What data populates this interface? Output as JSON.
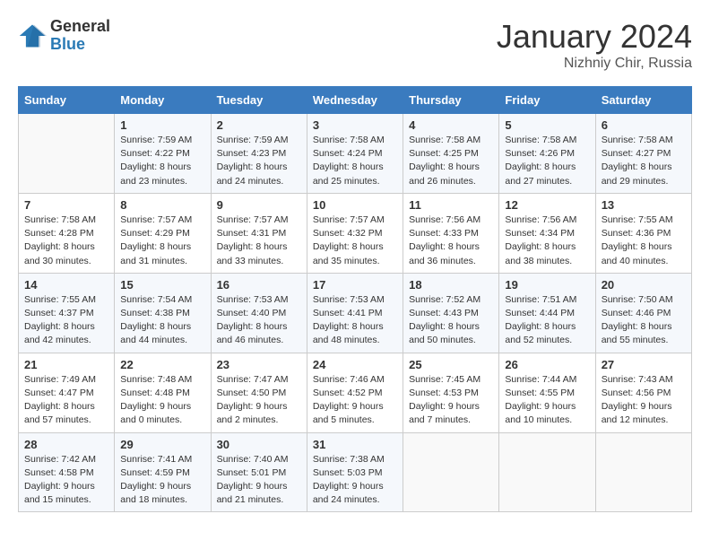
{
  "header": {
    "logo_general": "General",
    "logo_blue": "Blue",
    "month_year": "January 2024",
    "location": "Nizhniy Chir, Russia"
  },
  "weekdays": [
    "Sunday",
    "Monday",
    "Tuesday",
    "Wednesday",
    "Thursday",
    "Friday",
    "Saturday"
  ],
  "weeks": [
    [
      {
        "day": "",
        "info": ""
      },
      {
        "day": "1",
        "info": "Sunrise: 7:59 AM\nSunset: 4:22 PM\nDaylight: 8 hours\nand 23 minutes."
      },
      {
        "day": "2",
        "info": "Sunrise: 7:59 AM\nSunset: 4:23 PM\nDaylight: 8 hours\nand 24 minutes."
      },
      {
        "day": "3",
        "info": "Sunrise: 7:58 AM\nSunset: 4:24 PM\nDaylight: 8 hours\nand 25 minutes."
      },
      {
        "day": "4",
        "info": "Sunrise: 7:58 AM\nSunset: 4:25 PM\nDaylight: 8 hours\nand 26 minutes."
      },
      {
        "day": "5",
        "info": "Sunrise: 7:58 AM\nSunset: 4:26 PM\nDaylight: 8 hours\nand 27 minutes."
      },
      {
        "day": "6",
        "info": "Sunrise: 7:58 AM\nSunset: 4:27 PM\nDaylight: 8 hours\nand 29 minutes."
      }
    ],
    [
      {
        "day": "7",
        "info": "Sunrise: 7:58 AM\nSunset: 4:28 PM\nDaylight: 8 hours\nand 30 minutes."
      },
      {
        "day": "8",
        "info": "Sunrise: 7:57 AM\nSunset: 4:29 PM\nDaylight: 8 hours\nand 31 minutes."
      },
      {
        "day": "9",
        "info": "Sunrise: 7:57 AM\nSunset: 4:31 PM\nDaylight: 8 hours\nand 33 minutes."
      },
      {
        "day": "10",
        "info": "Sunrise: 7:57 AM\nSunset: 4:32 PM\nDaylight: 8 hours\nand 35 minutes."
      },
      {
        "day": "11",
        "info": "Sunrise: 7:56 AM\nSunset: 4:33 PM\nDaylight: 8 hours\nand 36 minutes."
      },
      {
        "day": "12",
        "info": "Sunrise: 7:56 AM\nSunset: 4:34 PM\nDaylight: 8 hours\nand 38 minutes."
      },
      {
        "day": "13",
        "info": "Sunrise: 7:55 AM\nSunset: 4:36 PM\nDaylight: 8 hours\nand 40 minutes."
      }
    ],
    [
      {
        "day": "14",
        "info": "Sunrise: 7:55 AM\nSunset: 4:37 PM\nDaylight: 8 hours\nand 42 minutes."
      },
      {
        "day": "15",
        "info": "Sunrise: 7:54 AM\nSunset: 4:38 PM\nDaylight: 8 hours\nand 44 minutes."
      },
      {
        "day": "16",
        "info": "Sunrise: 7:53 AM\nSunset: 4:40 PM\nDaylight: 8 hours\nand 46 minutes."
      },
      {
        "day": "17",
        "info": "Sunrise: 7:53 AM\nSunset: 4:41 PM\nDaylight: 8 hours\nand 48 minutes."
      },
      {
        "day": "18",
        "info": "Sunrise: 7:52 AM\nSunset: 4:43 PM\nDaylight: 8 hours\nand 50 minutes."
      },
      {
        "day": "19",
        "info": "Sunrise: 7:51 AM\nSunset: 4:44 PM\nDaylight: 8 hours\nand 52 minutes."
      },
      {
        "day": "20",
        "info": "Sunrise: 7:50 AM\nSunset: 4:46 PM\nDaylight: 8 hours\nand 55 minutes."
      }
    ],
    [
      {
        "day": "21",
        "info": "Sunrise: 7:49 AM\nSunset: 4:47 PM\nDaylight: 8 hours\nand 57 minutes."
      },
      {
        "day": "22",
        "info": "Sunrise: 7:48 AM\nSunset: 4:48 PM\nDaylight: 9 hours\nand 0 minutes."
      },
      {
        "day": "23",
        "info": "Sunrise: 7:47 AM\nSunset: 4:50 PM\nDaylight: 9 hours\nand 2 minutes."
      },
      {
        "day": "24",
        "info": "Sunrise: 7:46 AM\nSunset: 4:52 PM\nDaylight: 9 hours\nand 5 minutes."
      },
      {
        "day": "25",
        "info": "Sunrise: 7:45 AM\nSunset: 4:53 PM\nDaylight: 9 hours\nand 7 minutes."
      },
      {
        "day": "26",
        "info": "Sunrise: 7:44 AM\nSunset: 4:55 PM\nDaylight: 9 hours\nand 10 minutes."
      },
      {
        "day": "27",
        "info": "Sunrise: 7:43 AM\nSunset: 4:56 PM\nDaylight: 9 hours\nand 12 minutes."
      }
    ],
    [
      {
        "day": "28",
        "info": "Sunrise: 7:42 AM\nSunset: 4:58 PM\nDaylight: 9 hours\nand 15 minutes."
      },
      {
        "day": "29",
        "info": "Sunrise: 7:41 AM\nSunset: 4:59 PM\nDaylight: 9 hours\nand 18 minutes."
      },
      {
        "day": "30",
        "info": "Sunrise: 7:40 AM\nSunset: 5:01 PM\nDaylight: 9 hours\nand 21 minutes."
      },
      {
        "day": "31",
        "info": "Sunrise: 7:38 AM\nSunset: 5:03 PM\nDaylight: 9 hours\nand 24 minutes."
      },
      {
        "day": "",
        "info": ""
      },
      {
        "day": "",
        "info": ""
      },
      {
        "day": "",
        "info": ""
      }
    ]
  ]
}
